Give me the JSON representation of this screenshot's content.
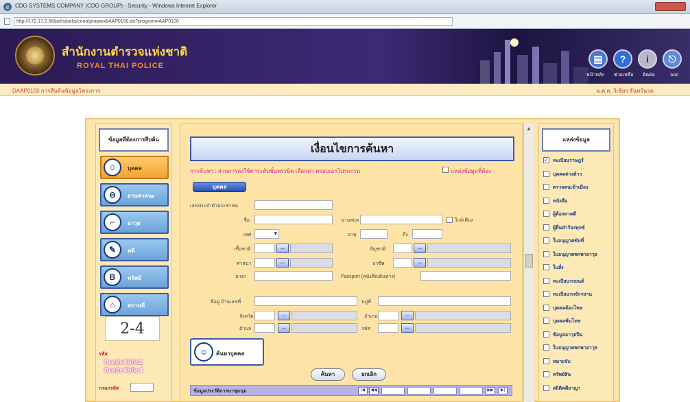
{
  "window": {
    "title": "CDG SYSTEMS COMPANY (CDG GROUP) - Security - Windows Internet Explorer",
    "url": "http://172.17.2.66/polis/polis/cona/propand/AAP0100.do?program=AAP0100"
  },
  "banner": {
    "org_thai": "สำนักงานตำรวจแห่งชาติ",
    "org_eng": "ROYAL THAI POLICE",
    "icons": [
      {
        "name": "home-icon",
        "label": "หน้าหลัก"
      },
      {
        "name": "help-icon",
        "label": "ช่วยเหลือ"
      },
      {
        "name": "info-icon",
        "label": "ติดต่อ"
      },
      {
        "name": "logout-icon",
        "label": "ออก"
      }
    ]
  },
  "breadcrumb": {
    "text": "DAAP0100 การสืบค้นข้อมูลโครงการ",
    "user": "ผ.ค.ต. วิเชียร จันทร์นวล"
  },
  "left": {
    "header": "ข้อมูลที่ต้องการสืบค้น",
    "items": [
      {
        "label": "บุคคล",
        "icon": "person-icon",
        "glyph": "☺"
      },
      {
        "label": "ยานพาหนะ",
        "icon": "vehicle-icon",
        "glyph": "⊖"
      },
      {
        "label": "อาวุธ",
        "icon": "gun-icon",
        "glyph": "⌐"
      },
      {
        "label": "คดี",
        "icon": "case-icon",
        "glyph": "✎"
      },
      {
        "label": "ทรัพย์",
        "icon": "property-icon",
        "glyph": "B"
      },
      {
        "label": "สถานที่",
        "icon": "place-icon",
        "glyph": "⌂"
      }
    ],
    "captcha": "2-4",
    "captcha_label": "รหัส",
    "captcha_code": "0xe2c4b0c2 0xe2c4b0c4",
    "captcha_input_label": "กรอกรหัส"
  },
  "form": {
    "title": "เงื่อนไขการค้นหา",
    "hint": "การค้นหา : ส่วนการลงใช้ค่าระดับขั้นพรรษิต เลือกค่า ครอบเอกโปรแกรม",
    "hint_checkbox_label": "แหล่งข้อมูลที่ต้อง",
    "tab_label": "บุคคล",
    "fields": {
      "id_card": "เลขประจำตัวประชาชน",
      "name": "ชื่อ",
      "surname": "นามสกุล",
      "similar": "ใกล้เคียง",
      "sex": "เพศ",
      "age": "อายุ",
      "to": "ถึง",
      "nationality": "เชื้อชาติ",
      "citizenship": "สัญชาติ",
      "religion": "ศาสนา",
      "occupation": "อาชีพ",
      "nickname": "ฉายา",
      "passport": "Passport (หนังสือเดินทาง)",
      "address_no": "ที่อยู่ บ้านเลขที่",
      "moo": "หมู่ที่",
      "province": "จังหวัด",
      "amphoe": "อำเภอ",
      "tambon": "ตำบล",
      "postcode": "รหัส"
    },
    "person_button": "ค้นหาบุคคล",
    "search_button": "ค้นหา",
    "clear_button": "ยกเลิก",
    "grid_title": "ข้อมูลประวัติการมาชุมนุม"
  },
  "right": {
    "header": "แหล่งข้อมูล",
    "items": [
      {
        "label": "ทะเบียนราษฎร์",
        "checked": true
      },
      {
        "label": "บุคคลต่างด้าว",
        "checked": false
      },
      {
        "label": "ตรวจคนเข้าเมือง",
        "checked": false
      },
      {
        "label": "หนังสือ",
        "checked": false
      },
      {
        "label": "ผู้ต้องหาคดี",
        "checked": false
      },
      {
        "label": "ผู้ยื่นคำร้องทุกข์",
        "checked": false
      },
      {
        "label": "ใบอนุญาตขับขี่",
        "checked": false
      },
      {
        "label": "ใบอนุญาตพกพาอาวุธ",
        "checked": false
      },
      {
        "label": "ใบสั่ง",
        "checked": false
      },
      {
        "label": "ทะเบียนรถยนต์",
        "checked": false
      },
      {
        "label": "ทะเบียนรถจักรยาน",
        "checked": false
      },
      {
        "label": "บุคคลต้องโทษ",
        "checked": false
      },
      {
        "label": "บุคคลพ้นโทษ",
        "checked": false
      },
      {
        "label": "ข้อมูลอาวุธปืน",
        "checked": false
      },
      {
        "label": "ใบอนุญาตพกพาอาวุธ",
        "checked": false
      },
      {
        "label": "หมายจับ",
        "checked": false
      },
      {
        "label": "ทรัพย์สิน",
        "checked": false
      },
      {
        "label": "สถิติคดีอาญา",
        "checked": false
      }
    ]
  },
  "colors": {
    "banner_bg": "#2b1a55",
    "breadcrumb_bg": "#fcebc0",
    "panel_bg": "#fde9b5",
    "accent_blue": "#3c5aa8",
    "hint_pink": "#d02a8a"
  }
}
